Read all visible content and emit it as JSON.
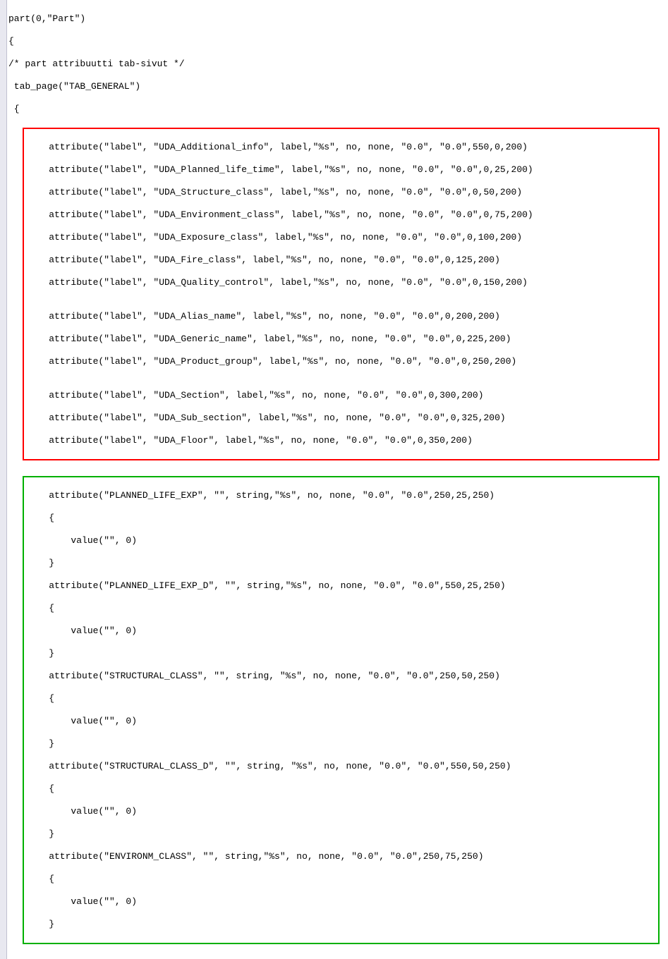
{
  "header": {
    "line1_a": "part(0",
    "line1_b": "\"Part\")",
    "line2": "{",
    "line3": "/* part attribuutti tab-sivut */",
    "line4": " tab_page(\"TAB_GENERAL\")",
    "line5": " {"
  },
  "redbox": {
    "l1": "    attribute(\"label\", \"UDA_Additional_info\", label,\"%s\", no, none, \"0.0\", \"0.0\",550,0,200)",
    "l2": "    attribute(\"label\", \"UDA_Planned_life_time\", label,\"%s\", no, none, \"0.0\", \"0.0\",0,25,200)",
    "l3": "    attribute(\"label\", \"UDA_Structure_class\", label,\"%s\", no, none, \"0.0\", \"0.0\",0,50,200)",
    "l4": "    attribute(\"label\", \"UDA_Environment_class\", label,\"%s\", no, none, \"0.0\", \"0.0\",0,75,200)",
    "l5": "    attribute(\"label\", \"UDA_Exposure_class\", label,\"%s\", no, none, \"0.0\", \"0.0\",0,100,200)",
    "l6": "    attribute(\"label\", \"UDA_Fire_class\", label,\"%s\", no, none, \"0.0\", \"0.0\",0,125,200)",
    "l7": "    attribute(\"label\", \"UDA_Quality_control\", label,\"%s\", no, none, \"0.0\", \"0.0\",0,150,200)",
    "blank1": "",
    "l8": "    attribute(\"label\", \"UDA_Alias_name\", label,\"%s\", no, none, \"0.0\", \"0.0\",0,200,200)",
    "l9": "    attribute(\"label\", \"UDA_Generic_name\", label,\"%s\", no, none, \"0.0\", \"0.0\",0,225,200)",
    "l10": "    attribute(\"label\", \"UDA_Product_group\", label,\"%s\", no, none, \"0.0\", \"0.0\",0,250,200)",
    "blank2": "",
    "l11": "    attribute(\"label\", \"UDA_Section\", label,\"%s\", no, none, \"0.0\", \"0.0\",0,300,200)",
    "l12": "    attribute(\"label\", \"UDA_Sub_section\", label,\"%s\", no, none, \"0.0\", \"0.0\",0,325,200)",
    "l13": "    attribute(\"label\", \"UDA_Floor\", label,\"%s\", no, none, \"0.0\", \"0.0\",0,350,200)"
  },
  "greenbox": {
    "g1": "    attribute(\"PLANNED_LIFE_EXP\", \"\", string,\"%s\", no, none, \"0.0\", \"0.0\",250,25,250)",
    "g2": "    {",
    "g3": "        value(\"\", 0)",
    "g4": "    }",
    "g5": "    attribute(\"PLANNED_LIFE_EXP_D\", \"\", string,\"%s\", no, none, \"0.0\", \"0.0\",550,25,250)",
    "g6": "    {",
    "g7": "        value(\"\", 0)",
    "g8": "    }",
    "g9": "    attribute(\"STRUCTURAL_CLASS\", \"\", string, \"%s\", no, none, \"0.0\", \"0.0\",250,50,250)",
    "g10": "    {",
    "g11": "        value(\"\", 0)",
    "g12": "    }",
    "g13": "    attribute(\"STRUCTURAL_CLASS_D\", \"\", string, \"%s\", no, none, \"0.0\", \"0.0\",550,50,250)",
    "g14": "    {",
    "g15": "        value(\"\", 0)",
    "g16": "    }",
    "g17": "    attribute(\"ENVIRONM_CLASS\", \"\", string,\"%s\", no, none, \"0.0\", \"0.0\",250,75,250)",
    "g18": "    {",
    "g19": "        value(\"\", 0)",
    "g20": "    }"
  }
}
